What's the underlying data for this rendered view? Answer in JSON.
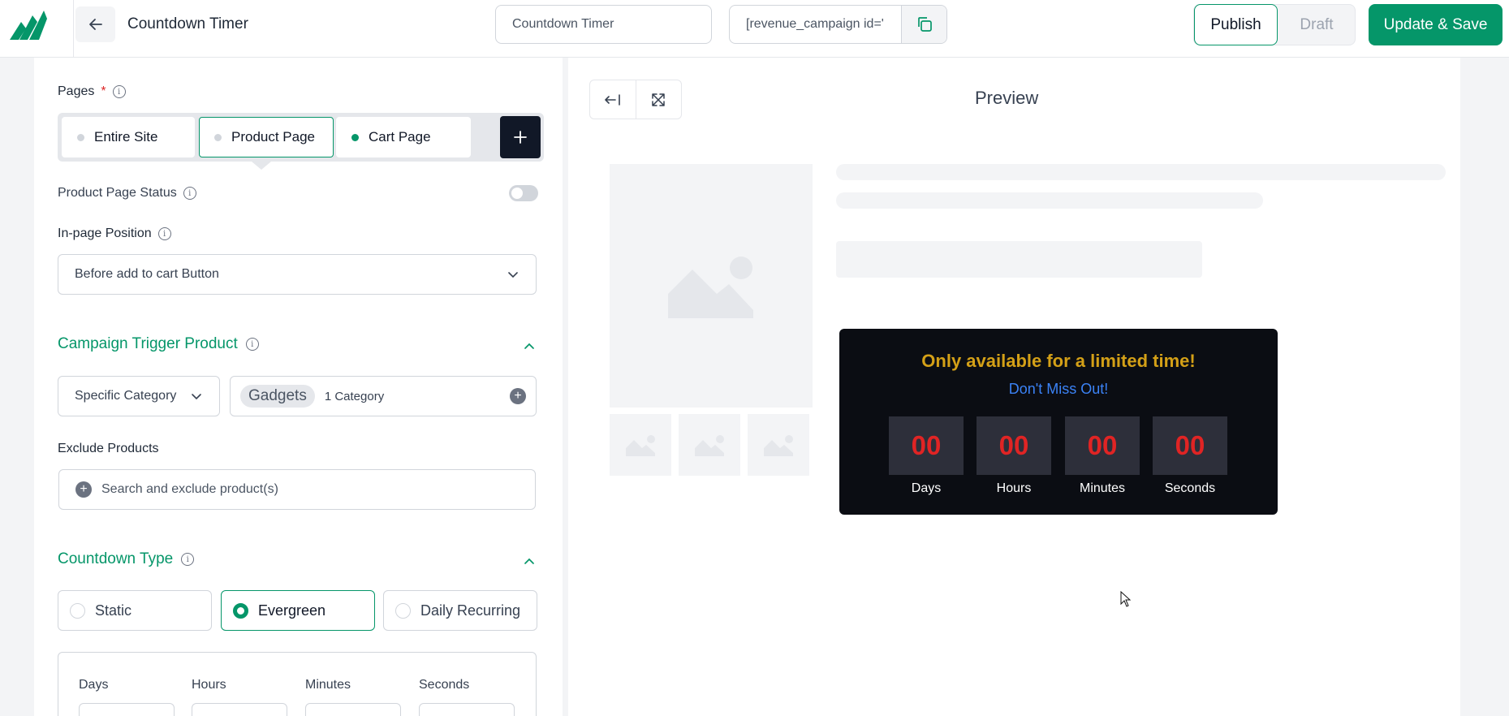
{
  "header": {
    "app_title": "Countdown Timer",
    "campaign_name_value": "Countdown Timer",
    "shortcode": "[revenue_campaign id='",
    "publish_label": "Publish",
    "draft_label": "Draft",
    "save_label": "Update & Save",
    "brand_color": "#059669"
  },
  "pages": {
    "label": "Pages",
    "required_mark": "*",
    "tabs": [
      {
        "label": "Entire Site",
        "state": "inactive"
      },
      {
        "label": "Product Page",
        "state": "selected"
      },
      {
        "label": "Cart Page",
        "state": "enabled"
      }
    ]
  },
  "status": {
    "label": "Product Page Status",
    "enabled": false
  },
  "position": {
    "label": "In-page Position",
    "value": "Before add to cart Button"
  },
  "trigger": {
    "title": "Campaign Trigger Product",
    "type_value": "Specific Category",
    "chip": "Gadgets",
    "count": "1 Category"
  },
  "exclude": {
    "label": "Exclude Products",
    "placeholder": "Search and exclude product(s)"
  },
  "countdown_type": {
    "title": "Countdown Type",
    "options": [
      {
        "label": "Static",
        "selected": false
      },
      {
        "label": "Evergreen",
        "selected": true
      },
      {
        "label": "Daily Recurring",
        "selected": false
      }
    ]
  },
  "duration": {
    "labels": [
      "Days",
      "Hours",
      "Minutes",
      "Seconds"
    ]
  },
  "preview": {
    "title": "Preview",
    "timer": {
      "heading": "Only available for a limited time!",
      "subheading": "Don't Miss Out!",
      "units": [
        {
          "value": "00",
          "label": "Days"
        },
        {
          "value": "00",
          "label": "Hours"
        },
        {
          "value": "00",
          "label": "Minutes"
        },
        {
          "value": "00",
          "label": "Seconds"
        }
      ],
      "heading_color": "#d4a017",
      "subheading_color": "#3b82f6",
      "digit_color": "#e02424",
      "background": "#0b0d13"
    }
  }
}
